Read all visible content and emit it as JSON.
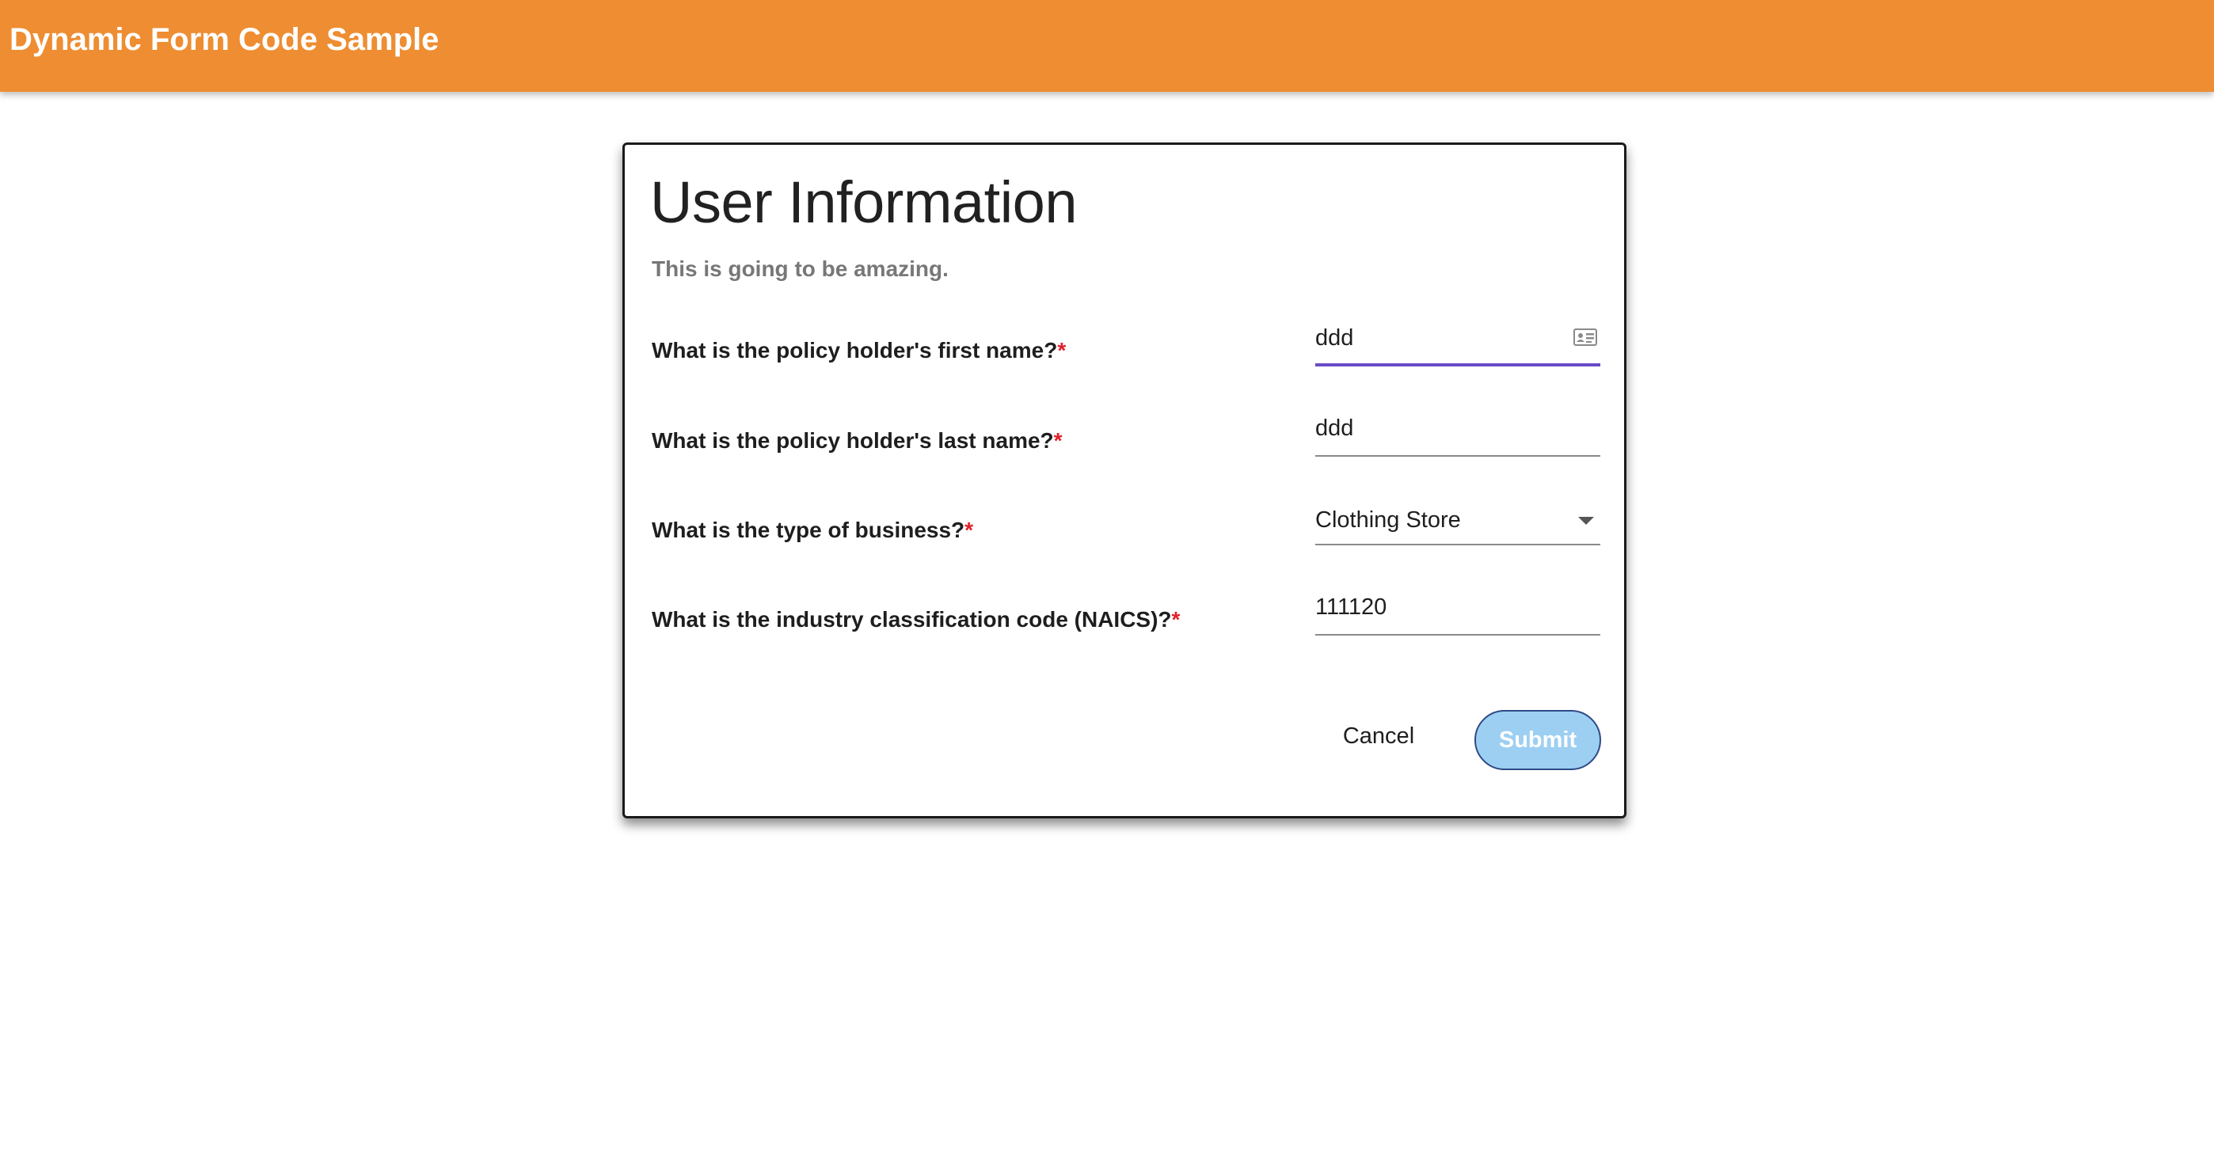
{
  "header": {
    "title": "Dynamic Form Code Sample"
  },
  "form": {
    "title": "User Information",
    "subtitle": "This is going to be amazing.",
    "required_marker": "*",
    "questions": [
      {
        "label": "What is the policy holder's first name?",
        "type": "text",
        "value": "ddd",
        "icon": "contact-card-icon",
        "focused": true
      },
      {
        "label": "What is the policy holder's last name?",
        "type": "text",
        "value": "ddd"
      },
      {
        "label": "What is the type of business?",
        "type": "select",
        "value": "Clothing Store",
        "icon": "chevron-down-icon"
      },
      {
        "label": "What is the industry classification code (NAICS)?",
        "type": "text",
        "value": "111120"
      }
    ],
    "actions": {
      "cancel_label": "Cancel",
      "submit_label": "Submit"
    }
  },
  "colors": {
    "header_bg": "#ee8d31",
    "focus_underline": "#6a4bc6",
    "required": "#e0202a",
    "submit_bg": "#9ccff2",
    "submit_border": "#2e4a86"
  }
}
